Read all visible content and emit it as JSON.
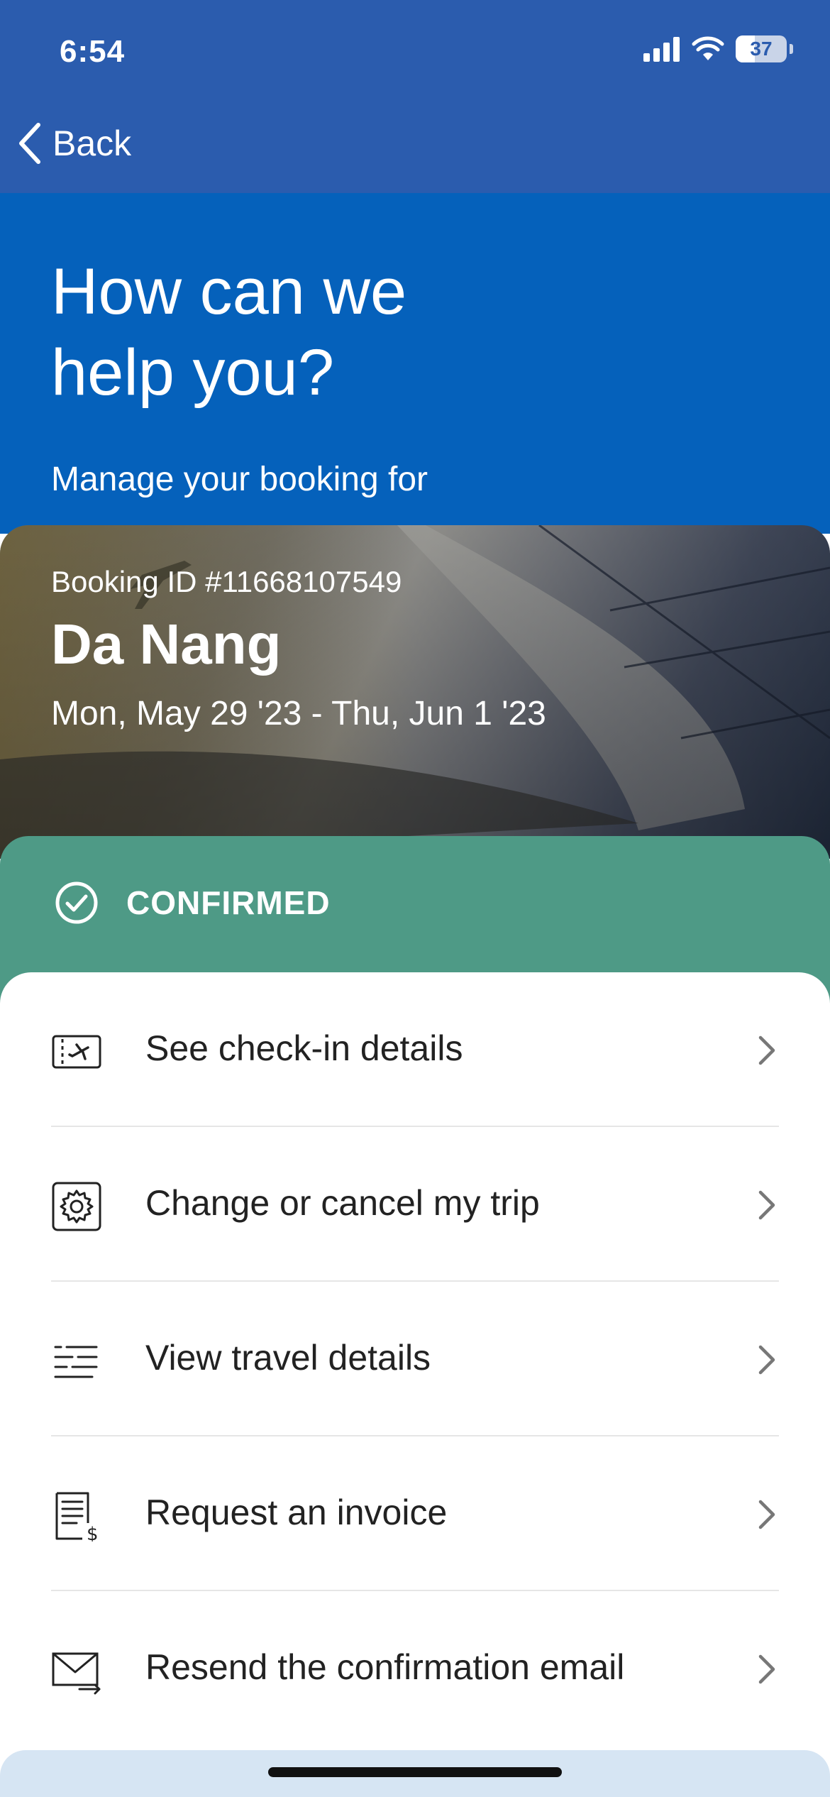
{
  "status_bar": {
    "time": "6:54",
    "battery": "37",
    "icons": [
      "signal-icon",
      "wifi-icon",
      "battery-icon"
    ]
  },
  "nav": {
    "back_label": "Back"
  },
  "hero": {
    "title": "How can we help you?",
    "subtitle": "Manage your booking for"
  },
  "booking": {
    "id_text": "Booking ID #11668107549",
    "city": "Da Nang",
    "dates": "Mon, May 29 '23 - Thu, Jun 1 '23"
  },
  "status": {
    "label": "CONFIRMED",
    "color": "#4e9a86"
  },
  "menu": {
    "items": [
      {
        "label": "See check-in details",
        "icon": "boarding-pass-icon"
      },
      {
        "label": "Change or cancel my trip",
        "icon": "settings-gear-icon"
      },
      {
        "label": "View travel details",
        "icon": "list-lines-icon"
      },
      {
        "label": "Request an invoice",
        "icon": "invoice-icon"
      },
      {
        "label": "Resend the confirmation email",
        "icon": "email-arrow-icon"
      }
    ]
  },
  "colors": {
    "topbar": "#2b5cae",
    "hero": "#0561bb",
    "confirmed": "#4e9a86"
  }
}
